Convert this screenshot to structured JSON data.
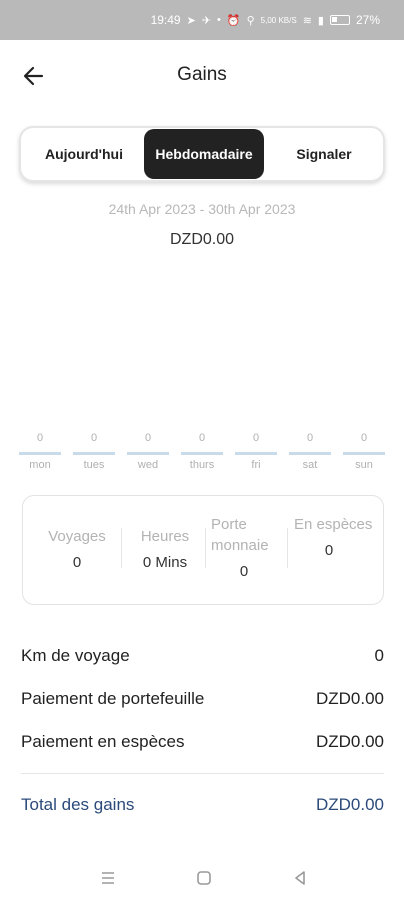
{
  "status_bar": {
    "time": "19:49",
    "speed": "5,00 KB/S",
    "battery": "27%"
  },
  "header": {
    "title": "Gains",
    "back_icon": "arrow-left-icon"
  },
  "tabs": [
    {
      "label": "Aujourd'hui",
      "selected": false
    },
    {
      "label": "Hebdomadaire",
      "selected": true
    },
    {
      "label": "Signaler",
      "selected": false
    }
  ],
  "period": {
    "range": "24th Apr 2023 - 30th Apr 2023",
    "total": "DZD0.00"
  },
  "week": [
    {
      "day": "mon",
      "value": "0"
    },
    {
      "day": "tues",
      "value": "0"
    },
    {
      "day": "wed",
      "value": "0"
    },
    {
      "day": "thurs",
      "value": "0"
    },
    {
      "day": "fri",
      "value": "0"
    },
    {
      "day": "sat",
      "value": "0"
    },
    {
      "day": "sun",
      "value": "0"
    }
  ],
  "summary": {
    "trips_label": "Voyages",
    "trips_value": "0",
    "hours_label": "Heures",
    "hours_value": "0 Mins",
    "wallet_label": "Porte monnaie",
    "wallet_value": "0",
    "cash_label": "En espèces",
    "cash_value": "0"
  },
  "details": {
    "km_label": "Km de voyage",
    "km_value": "0",
    "wallet_payment_label": "Paiement de portefeuille",
    "wallet_payment_value": "DZD0.00",
    "cash_payment_label": "Paiement en espèces",
    "cash_payment_value": "DZD0.00",
    "total_label": "Total des gains",
    "total_value": "DZD0.00"
  },
  "colors": {
    "accent": "#2b4a7a",
    "selected_tab": "#222222",
    "bar": "#c9dbe9"
  }
}
